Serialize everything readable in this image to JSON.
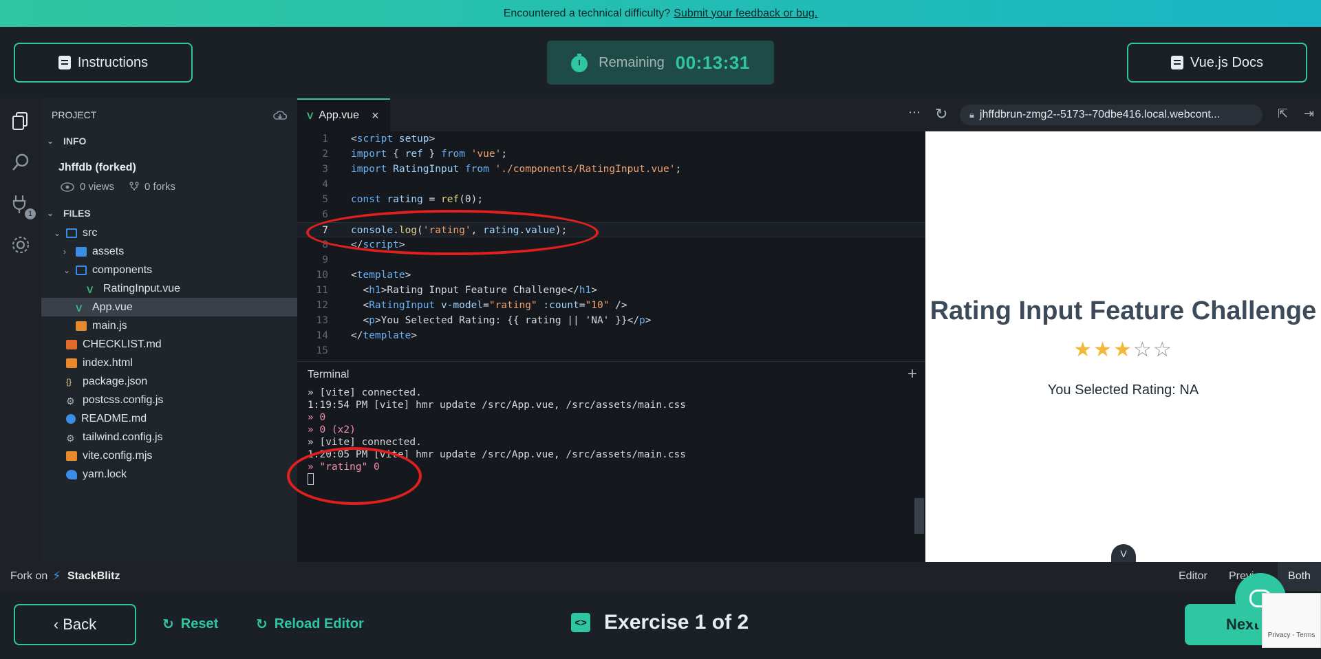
{
  "banner": {
    "text": "Encountered a technical difficulty?",
    "link": "Submit your feedback or bug."
  },
  "header": {
    "instructions_label": "Instructions",
    "timer_label": "Remaining",
    "timer_value": "00:13:31",
    "docs_label": "Vue.js Docs"
  },
  "sidebar": {
    "project_label": "PROJECT",
    "info_label": "INFO",
    "project_name": "Jhffdb (forked)",
    "views": "0 views",
    "forks": "0 forks",
    "files_label": "FILES",
    "files": [
      "src",
      "assets",
      "components",
      "RatingInput.vue",
      "App.vue",
      "main.js",
      "CHECKLIST.md",
      "index.html",
      "package.json",
      "postcss.config.js",
      "README.md",
      "tailwind.config.js",
      "vite.config.mjs",
      "yarn.lock"
    ],
    "activity_badge": "1"
  },
  "editor": {
    "tab_label": "App.vue",
    "line_numbers": [
      "1",
      "2",
      "3",
      "4",
      "5",
      "6",
      "7",
      "8",
      "9",
      "10",
      "11",
      "12",
      "13",
      "14",
      "15"
    ],
    "current_line": 7
  },
  "terminal": {
    "title": "Terminal",
    "lines": [
      "» [vite] connected.",
      "1:19:54 PM [vite] hmr update /src/App.vue, /src/assets/main.css",
      "» 0",
      "» 0 (x2)",
      "» [vite] connected.",
      "1:20:05 PM [vite] hmr update /src/App.vue, /src/assets/main.css",
      "» \"rating\" 0"
    ]
  },
  "preview": {
    "url": "jhffdbrun-zmg2--5173--70dbe416.local.webcont...",
    "title": "Rating Input Feature Challenge",
    "rating_filled": 3,
    "rating_total": 5,
    "selected_text": "You Selected Rating: NA"
  },
  "statusbar": {
    "fork_label": "Fork on",
    "brand": "StackBlitz",
    "view_editor": "Editor",
    "view_preview": "Previ",
    "view_both": "Both"
  },
  "footer": {
    "back_label": "‹ Back",
    "reset_label": "Reset",
    "reload_label": "Reload Editor",
    "exercise_label": "Exercise 1 of 2",
    "next_label": "Next",
    "recaptcha": "Privacy - Terms"
  },
  "colors": {
    "accent": "#2ec7a1",
    "annotation": "#e01f1f",
    "star": "#f2b93a"
  }
}
